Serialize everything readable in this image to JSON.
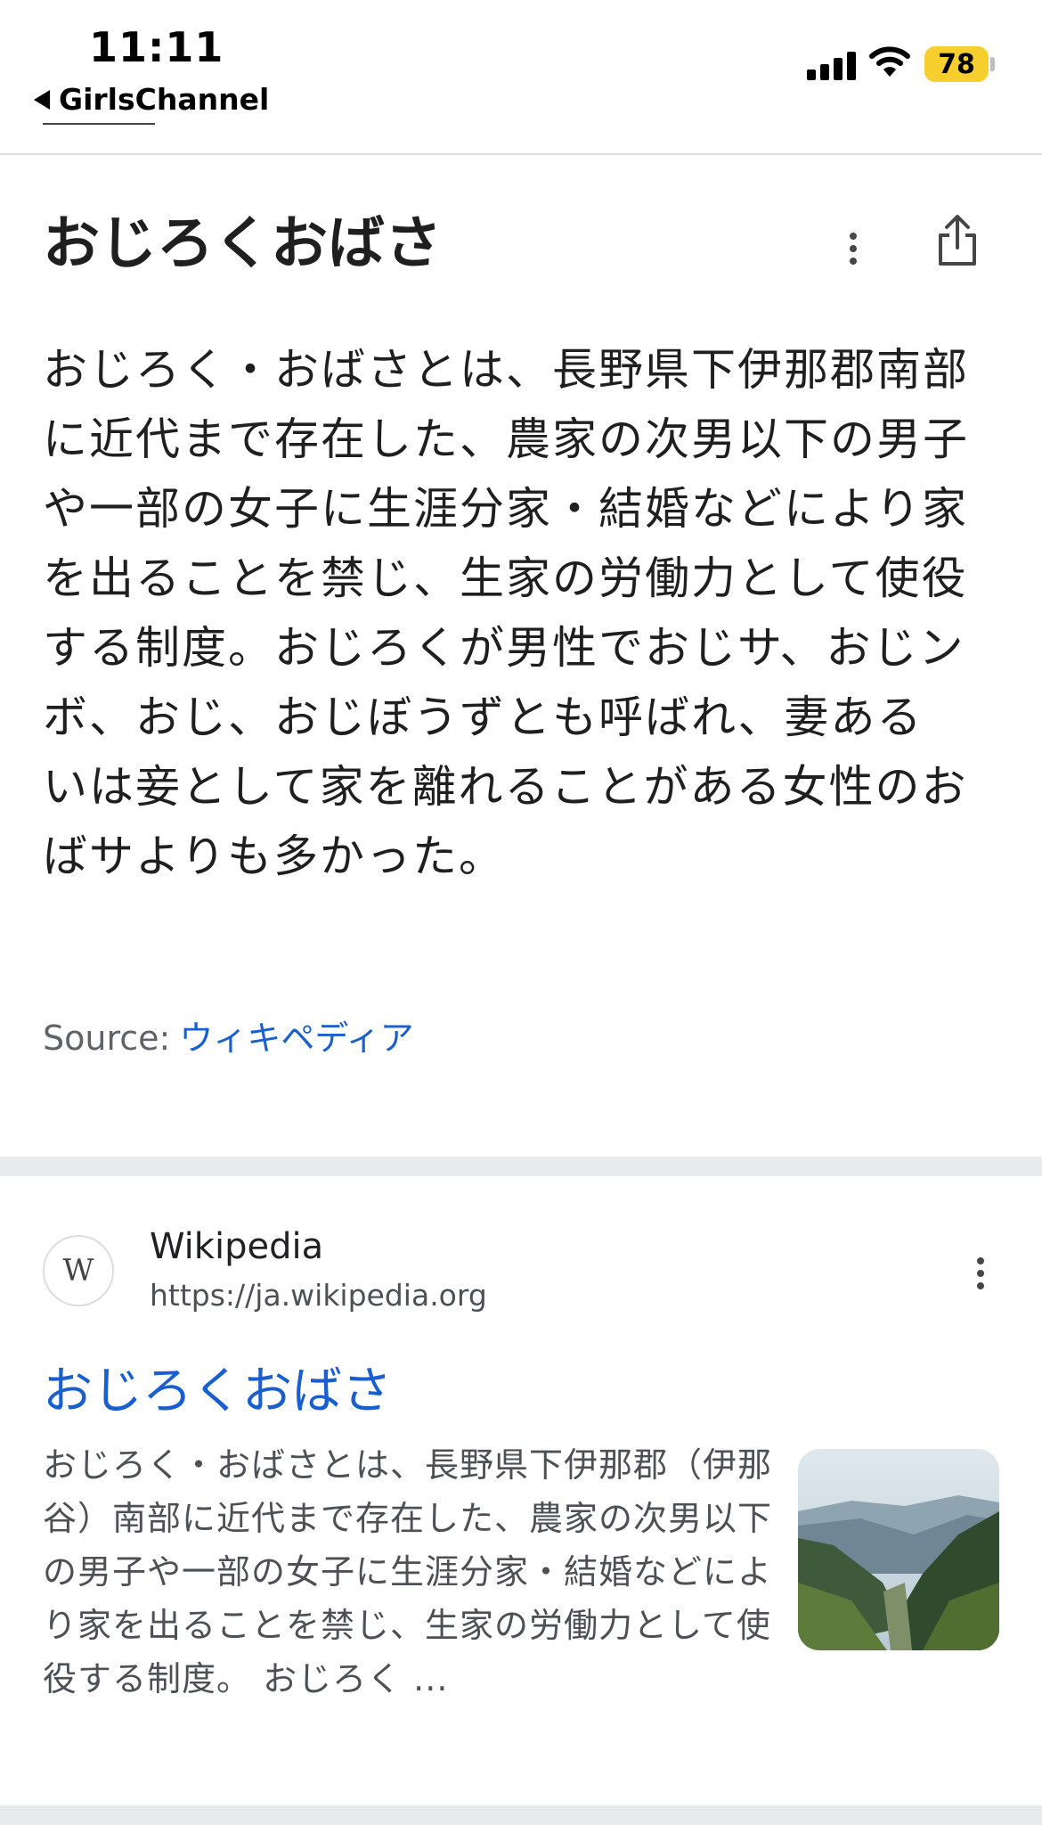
{
  "status_bar": {
    "time": "11:11",
    "back_label": "GirlsChannel",
    "battery": "78",
    "battery_color": "#f6cf2e"
  },
  "knowledge_panel": {
    "title": "おじろくおばさ",
    "description": "おじろく・おばさとは、長野県下伊那郡南部に近代まで存在した、農家の次男以下の男子や一部の女子に生涯分家・結婚などにより家を出ることを禁じ、生家の労働力として使役する制度。おじろくが男性でおじサ、おじンボ、おじ、おじぼうずとも呼ばれ、妻あるいは妾として家を離れることがある女性のおばサよりも多かった。",
    "source_label": "Source:",
    "source_link": "ウィキペディア",
    "icons": [
      "more-vert-icon",
      "share-icon"
    ]
  },
  "result": {
    "site_name": "Wikipedia",
    "site_url": "https://ja.wikipedia.org",
    "favicon_letter": "W",
    "title": "おじろくおばさ",
    "snippet": "おじろく・おばさとは、長野県下伊那郡（伊那谷）南部に近代まで存在した、農家の次男以下の男子や一部の女子に生涯分家・結婚などにより家を出ることを禁じ、生家の労働力として使役する制度。 おじろく ...",
    "link_color": "#1a5fd0"
  }
}
